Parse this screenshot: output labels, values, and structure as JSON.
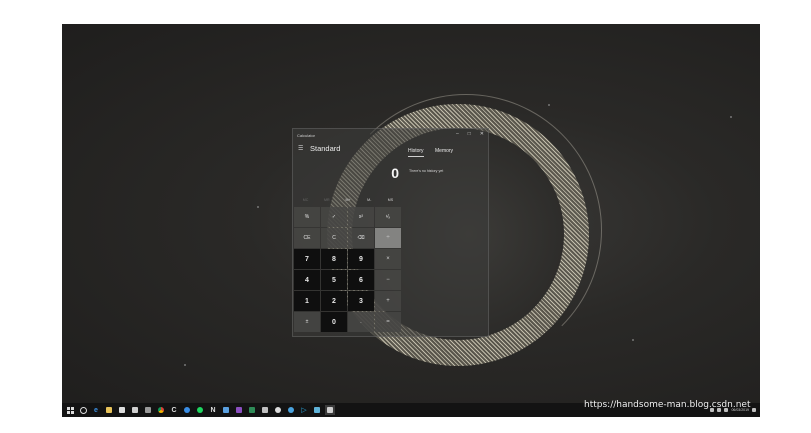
{
  "window": {
    "app_title": "Calculator",
    "controls": {
      "minimize": "–",
      "maximize": "□",
      "close": "✕"
    },
    "mode_title": "Standard",
    "menu_icon": "☰"
  },
  "tabs": {
    "history": "History",
    "memory": "Memory"
  },
  "history": {
    "empty_text": "There's no history yet"
  },
  "display": {
    "value": "0"
  },
  "memory_buttons": [
    {
      "label": "MC",
      "enabled": false
    },
    {
      "label": "MR",
      "enabled": false
    },
    {
      "label": "M+",
      "enabled": true
    },
    {
      "label": "M-",
      "enabled": true
    },
    {
      "label": "MS",
      "enabled": true
    }
  ],
  "keys": [
    [
      "%",
      "✓",
      "x²",
      "¹⁄ₓ"
    ],
    [
      "CE",
      "C",
      "⌫",
      "÷"
    ],
    [
      "7",
      "8",
      "9",
      "×"
    ],
    [
      "4",
      "5",
      "6",
      "−"
    ],
    [
      "1",
      "2",
      "3",
      "+"
    ],
    [
      "±",
      "0",
      ".",
      "="
    ]
  ],
  "taskbar": {
    "start_icon": "windows-icon",
    "icons": [
      "cortana-icon",
      "edge-icon",
      "file-explorer-icon",
      "store-icon",
      "mail-icon",
      "photos-icon",
      "chrome-icon",
      "cortana-circle-icon",
      "spotify-icon",
      "notion-icon",
      "photo-viewer-icon",
      "onenote-icon",
      "excel-icon",
      "app-icon",
      "xbox-icon",
      "browser-icon",
      "media-icon",
      "app2-icon",
      "calculator-icon"
    ],
    "clock": {
      "time": "",
      "date": "06/03/2019"
    }
  },
  "watermark": "https://handsome-man.blog.csdn.net",
  "colors": {
    "desktop": "#2a2927",
    "calc_bg": "#3c3c3a",
    "number_key": "#0f0f0f",
    "taskbar": "#131313"
  }
}
